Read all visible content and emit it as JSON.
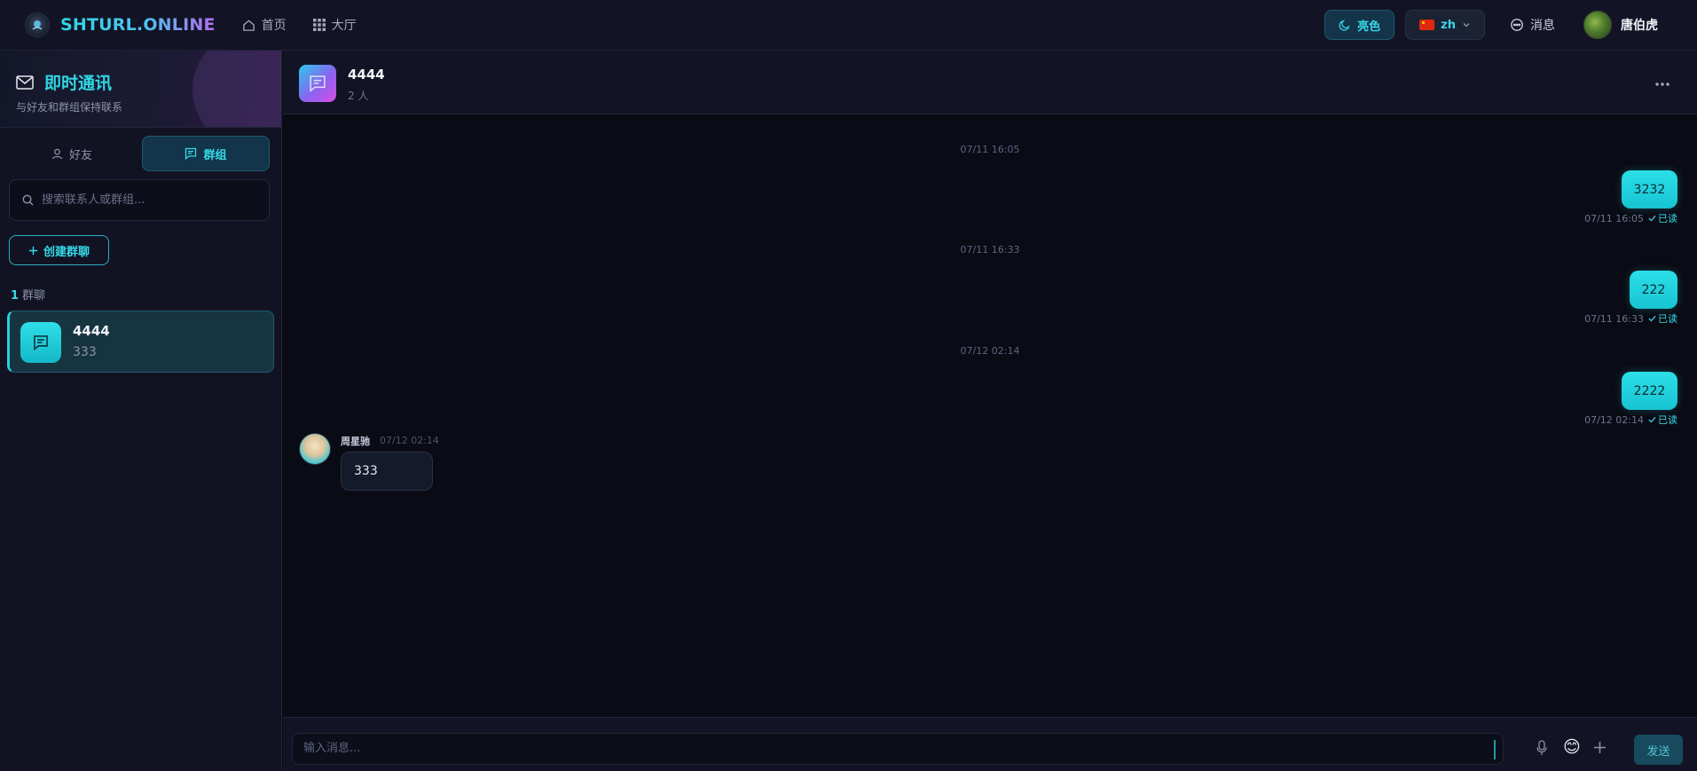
{
  "topbar": {
    "logo_text": "SHTURL.ONLINE",
    "nav": [
      {
        "label": "首页",
        "icon": "home-icon"
      },
      {
        "label": "大厅",
        "icon": "grid-icon"
      }
    ],
    "theme_label": "亮色",
    "lang_label": "zh",
    "messages_label": "消息",
    "user_name": "唐伯虎"
  },
  "sidebar": {
    "title": "即时通讯",
    "subtitle": "与好友和群组保持联系",
    "tabs": [
      {
        "label": "好友",
        "active": false
      },
      {
        "label": "群组",
        "active": true
      }
    ],
    "search_placeholder": "搜索联系人或群组...",
    "create_label": "创建群聊",
    "group_count": "1",
    "group_count_label": "群聊",
    "groups": [
      {
        "name": "4444",
        "last_message": "333"
      }
    ]
  },
  "chat": {
    "title": "4444",
    "member_count": "2 人",
    "messages": [
      {
        "type": "timestamp",
        "text": "07/11 16:05"
      },
      {
        "type": "outgoing",
        "text": "3232",
        "time": "07/11 16:05",
        "status": "已读"
      },
      {
        "type": "timestamp",
        "text": "07/11 16:33"
      },
      {
        "type": "outgoing",
        "text": "222",
        "time": "07/11 16:33",
        "status": "已读"
      },
      {
        "type": "timestamp",
        "text": "07/12 02:14"
      },
      {
        "type": "outgoing",
        "text": "2222",
        "time": "07/12 02:14",
        "status": "已读"
      },
      {
        "type": "incoming",
        "sender": "周星驰",
        "time": "07/12 02:14",
        "text": "333"
      }
    ]
  },
  "composer": {
    "placeholder": "输入消息...",
    "send_label": "发送",
    "emoji": "😊"
  },
  "colors": {
    "accent": "#2fd7e4",
    "background": "#0a0b14",
    "panel": "#121425"
  }
}
